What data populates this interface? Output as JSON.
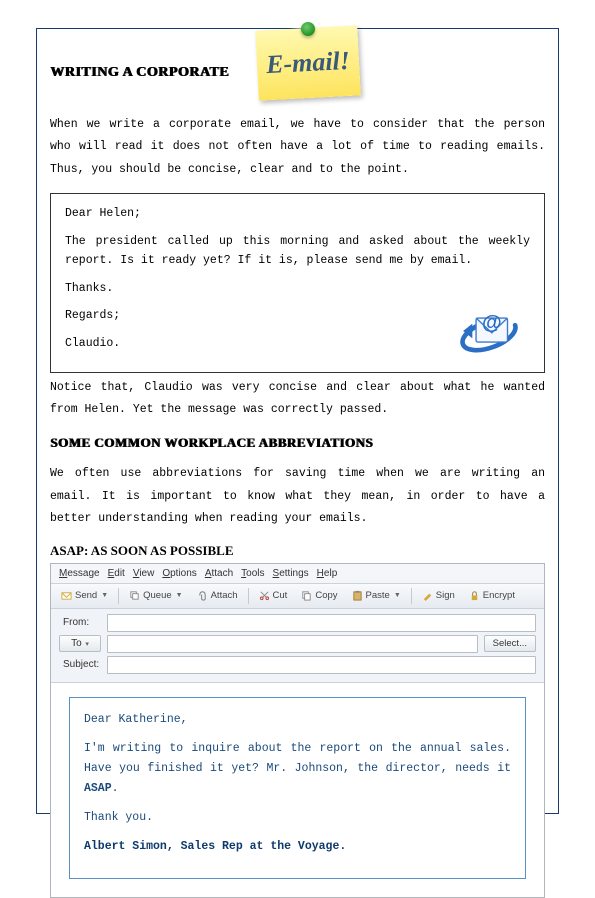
{
  "header": {
    "title": "Writing a Corporate",
    "sticky_text": "E-mail!"
  },
  "intro": "When we write a corporate email, we have to consider that the person who will read it does not often have a lot of time to reading emails. Thus, you should be concise, clear and to the point.",
  "sample_email": {
    "greeting": "Dear Helen;",
    "body": "The president called up this morning and asked about the weekly report. Is it ready yet? If it is, please send me by email.",
    "thanks": "Thanks.",
    "regards": "Regards;",
    "signature": "Claudio."
  },
  "after_email": "Notice that, Claudio was very concise and clear about what he wanted from Helen. Yet the message was correctly passed.",
  "section2_title": "Some Common Workplace Abbreviations",
  "abbrev_intro": "We often use abbreviations for saving time when we are writing an email. It is important to know what they mean, in order to have a better understanding when reading your emails.",
  "asap_heading": "ASAP: AS SOON AS POSSIBLE",
  "email_client": {
    "menu": [
      "Message",
      "Edit",
      "View",
      "Options",
      "Attach",
      "Tools",
      "Settings",
      "Help"
    ],
    "toolbar": {
      "send": "Send",
      "queue": "Queue",
      "attach": "Attach",
      "cut": "Cut",
      "copy": "Copy",
      "paste": "Paste",
      "sign": "Sign",
      "encrypt": "Encrypt"
    },
    "fields": {
      "from": "From:",
      "to": "To",
      "subject": "Subject:",
      "select": "Select..."
    },
    "compose": {
      "greeting": "Dear Katherine,",
      "body_pre": "I'm writing to inquire about the report on the annual sales. Have you finished it yet? Mr. Johnson, the director, needs it ",
      "asap": "ASAP",
      "body_post": ".",
      "thanks": "Thank you.",
      "signature": "Albert Simon, Sales Rep at the Voyage."
    }
  }
}
